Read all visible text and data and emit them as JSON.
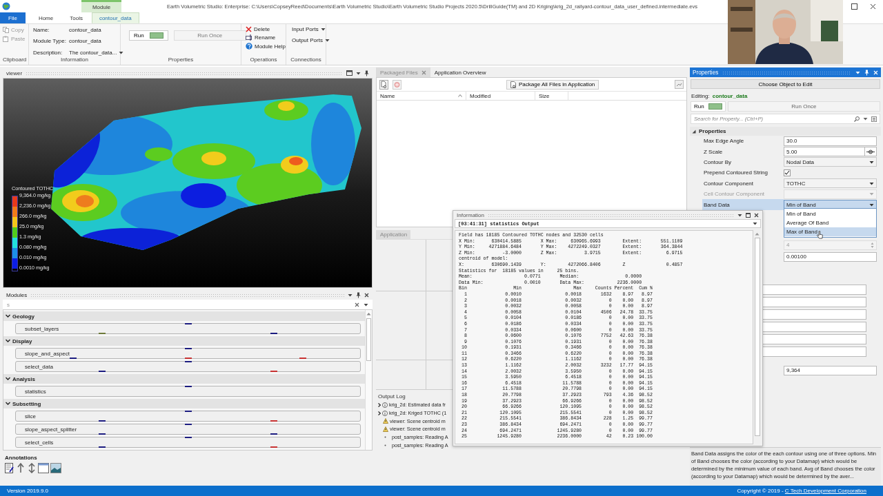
{
  "window": {
    "title": "Earth Volumetric Studio: Enterprise: C:\\Users\\CopseyReed\\Documents\\Earth Volumetric Studio\\Earth Volumetric Studio Projects 2020.5\\DrillGuide(TM) and 2D Kriging\\krig_2d_railyard-contour_data_user_defined.intermediate.evs",
    "context_group": "Module"
  },
  "ribbon_tabs": [
    {
      "label": "File",
      "kind": "file",
      "selected": false
    },
    {
      "label": "Home",
      "kind": "tab",
      "selected": false
    },
    {
      "label": "Tools",
      "kind": "tab",
      "selected": false
    },
    {
      "label": "contour_data",
      "kind": "context",
      "selected": true
    }
  ],
  "ribbon": {
    "clipboard": {
      "label": "Clipboard",
      "buttons": [
        {
          "label": "Copy",
          "kind": "copy",
          "disabled": true
        },
        {
          "label": "Paste",
          "kind": "paste",
          "disabled": true
        }
      ]
    },
    "information": {
      "label": "Information",
      "fields": [
        {
          "label": "Name:",
          "value": "contour_data",
          "kind": "text"
        },
        {
          "label": "Module Type:",
          "value": "contour_data",
          "kind": "text"
        },
        {
          "label": "Description:",
          "value": "The contour_data...",
          "kind": "dropdown"
        }
      ]
    },
    "properties": {
      "label": "Properties",
      "run": "Run",
      "run_once": "Run Once"
    },
    "operations": {
      "label": "Operations",
      "buttons": [
        {
          "label": "Delete",
          "kind": "delete"
        },
        {
          "label": "Rename",
          "kind": "rename"
        },
        {
          "label": "Module Help",
          "kind": "help"
        }
      ]
    },
    "connections": {
      "label": "Connections",
      "buttons": [
        {
          "label": "Input Ports"
        },
        {
          "label": "Output Ports"
        }
      ]
    }
  },
  "viewer": {
    "title": "viewer",
    "legend": {
      "title": "Contoured TOTHC",
      "labels": [
        "9,364.0 mg/kg",
        "2,236.0 mg/kg",
        "266.0 mg/kg",
        "25.0 mg/kg",
        "1.3 mg/kg",
        "0.080 mg/kg",
        "0.010 mg/kg",
        "0.0010 mg/kg"
      ],
      "bands": [
        {
          "color": "#e83a1c"
        },
        {
          "color": "#f07c1a"
        },
        {
          "color": "#f5c61a"
        },
        {
          "color": "#52cc1c"
        },
        {
          "color": "#22e0dc"
        },
        {
          "color": "#1c8ee8"
        },
        {
          "color": "#0c1ee6"
        }
      ]
    }
  },
  "modules": {
    "title": "Modules",
    "search_value": "s",
    "categories": [
      {
        "name": "Geology",
        "expanded": true,
        "items": [
          {
            "name": "subset_layers",
            "inputs": [
              {
                "color": "#1c1c80"
              }
            ],
            "outputs": [
              {
                "color": "#6e7a3a"
              },
              {
                "color": "#1c1c80"
              }
            ]
          }
        ]
      },
      {
        "name": "Display",
        "expanded": true,
        "items": [
          {
            "name": "slope_and_aspect",
            "inputs": [
              {
                "color": "#1c1c80"
              }
            ],
            "outputs": [
              {
                "color": "#1c1c80"
              },
              {
                "color": "#c83232"
              },
              {
                "color": "#c83232"
              }
            ]
          },
          {
            "name": "select_data",
            "inputs": [
              {
                "color": "#1c1c80"
              }
            ],
            "outputs": [
              {
                "color": "#1c1c80"
              },
              {
                "color": "#c83232"
              }
            ]
          }
        ]
      },
      {
        "name": "Analysis",
        "expanded": true,
        "items": [
          {
            "name": "statistics",
            "inputs": [
              {
                "color": "#1c1c80"
              }
            ]
          }
        ]
      },
      {
        "name": "Subsetting",
        "expanded": true,
        "items": [
          {
            "name": "slice",
            "inputs": [
              {
                "color": "#1c1c80"
              }
            ],
            "outputs": [
              {
                "color": "#1c1c80"
              },
              {
                "color": "#c83232"
              }
            ]
          },
          {
            "name": "slope_aspect_splitter",
            "inputs": [
              {
                "color": "#1c1c80"
              }
            ],
            "outputs": [
              {
                "color": "#1c1c80"
              },
              {
                "color": "#1c1c80"
              }
            ]
          },
          {
            "name": "select_cells",
            "inputs": [
              {
                "color": "#1c1c80"
              }
            ],
            "outputs": [
              {
                "color": "#1c1c80"
              },
              {
                "color": "#c83232"
              }
            ]
          }
        ]
      }
    ],
    "annotations_title": "Annotations"
  },
  "packaged_files": {
    "tabs": [
      {
        "label": "Packaged Files",
        "selected": true
      },
      {
        "label": "Application Overview",
        "selected": false
      }
    ],
    "package_button": "Package All Files in Application",
    "columns": [
      "Name",
      "Modified",
      "Size"
    ]
  },
  "application": {
    "title": "Application"
  },
  "output_log": {
    "title": "Output Log",
    "entries": [
      {
        "kind": "info",
        "text": "krig_2d: Estimated data fr"
      },
      {
        "kind": "info",
        "text": "krig_2d: Kriged TOTHC (1"
      },
      {
        "kind": "warning",
        "text": "viewer: Scene centroid m"
      },
      {
        "kind": "warning",
        "text": "viewer: Scene centroid m"
      },
      {
        "kind": "note",
        "text": "post_samples: Reading A"
      },
      {
        "kind": "note",
        "text": "post_samples: Reading A"
      }
    ]
  },
  "properties_panel": {
    "title": "Properties",
    "choose": "Choose Object to Edit",
    "editing_label": "Editing:",
    "editing_value": "contour_data",
    "run": "Run",
    "run_once": "Run Once",
    "search_placeholder": "Search for Property...  (Ctrl+P)",
    "section": "Properties",
    "rows": [
      {
        "label": "Max Edge Angle",
        "kind": "text",
        "value": "30.0",
        "selected": false,
        "disabled": false
      },
      {
        "label": "Z Scale",
        "kind": "text_button",
        "value": "5.00",
        "selected": false,
        "disabled": false
      },
      {
        "label": "Contour By",
        "kind": "dropdown",
        "value": "Nodal Data",
        "selected": false,
        "disabled": false
      },
      {
        "label": "Prepend Contoured String",
        "kind": "checkbox",
        "checked": true,
        "selected": false,
        "disabled": false
      },
      {
        "label": "Contour Component",
        "kind": "dropdown",
        "value": "TOTHC",
        "selected": false,
        "disabled": false
      },
      {
        "label": "Cell Contour Component",
        "kind": "dropdown",
        "selected": false,
        "disabled": true
      },
      {
        "label": "Band Data",
        "kind": "dropdown",
        "value": "Min of Band",
        "selected": true,
        "disabled": false
      }
    ],
    "band_data_options": [
      {
        "label": "Min of Band",
        "selected": false
      },
      {
        "label": "Average Of Band",
        "selected": false
      },
      {
        "label": "Max of Band",
        "selected": true
      }
    ],
    "lower_rows": [
      {
        "kind": "spin",
        "value": "4",
        "disabled": true
      },
      {
        "kind": "text",
        "value": "0.00100",
        "disabled": false
      },
      {
        "kind": "empty",
        "disabled": false
      },
      {
        "kind": "empty",
        "disabled": false
      },
      {
        "kind": "empty",
        "disabled": false
      },
      {
        "kind": "empty",
        "disabled": false
      },
      {
        "kind": "empty",
        "disabled": false
      },
      {
        "kind": "empty",
        "disabled": false
      },
      {
        "kind": "text",
        "value": "9,364",
        "disabled": false
      }
    ],
    "description": "Band Data assigns the color of the each contour using one of three options. Min of Band chooses the color (according to your Datamap) which would be determined by the minimum value of each band. Avg of Band chooses the color (according to your Datamap) which would be determined by the aver..."
  },
  "information_window": {
    "title": "Information",
    "header": "[03:41:31] statistics Output",
    "lines": [
      "Field has 18185 Contoured TOTHC nodes and 32530 cells",
      "X Min:      630414.5885       X Max:     630965.6993        Extent:       551.1109",
      "Y Min:     4271884.6484       Y Max:    4272249.0327        Extent:       364.3844",
      "Z Min:          -3.0000       Z Max:          3.9715        Extent:         6.9715",
      "centroid of model:",
      "X:          630690.1439       Y:        4272066.8406        Z               0.4857",
      "Statistics for  18185 values in     25 bins.",
      "Mean:                   0.0771       Median:                 0.0000",
      "Data Min:               0.0010       Data Max:            2236.0000"
    ],
    "bin_columns": [
      "Bin",
      "Min",
      "Max",
      "Counts",
      "Percent",
      "Cum %"
    ],
    "bins": [
      {
        "bin": "1",
        "min": "0.0010",
        "max": "0.0018",
        "counts": "1632",
        "percent": "8.97",
        "cum": "8.97"
      },
      {
        "bin": "2",
        "min": "0.0018",
        "max": "0.0032",
        "counts": "0",
        "percent": "0.00",
        "cum": "8.97"
      },
      {
        "bin": "3",
        "min": "0.0032",
        "max": "0.0058",
        "counts": "0",
        "percent": "0.00",
        "cum": "8.97"
      },
      {
        "bin": "4",
        "min": "0.0058",
        "max": "0.0104",
        "counts": "4506",
        "percent": "24.78",
        "cum": "33.75"
      },
      {
        "bin": "5",
        "min": "0.0104",
        "max": "0.0186",
        "counts": "0",
        "percent": "0.00",
        "cum": "33.75"
      },
      {
        "bin": "6",
        "min": "0.0186",
        "max": "0.0334",
        "counts": "0",
        "percent": "0.00",
        "cum": "33.75"
      },
      {
        "bin": "7",
        "min": "0.0334",
        "max": "0.0600",
        "counts": "0",
        "percent": "0.00",
        "cum": "33.75"
      },
      {
        "bin": "8",
        "min": "0.0600",
        "max": "0.1076",
        "counts": "7752",
        "percent": "42.63",
        "cum": "76.38"
      },
      {
        "bin": "9",
        "min": "0.1076",
        "max": "0.1931",
        "counts": "0",
        "percent": "0.00",
        "cum": "76.38"
      },
      {
        "bin": "10",
        "min": "0.1931",
        "max": "0.3466",
        "counts": "0",
        "percent": "0.00",
        "cum": "76.38"
      },
      {
        "bin": "11",
        "min": "0.3466",
        "max": "0.6220",
        "counts": "0",
        "percent": "0.00",
        "cum": "76.38"
      },
      {
        "bin": "12",
        "min": "0.6220",
        "max": "1.1162",
        "counts": "0",
        "percent": "0.00",
        "cum": "76.38"
      },
      {
        "bin": "13",
        "min": "1.1162",
        "max": "2.0032",
        "counts": "3232",
        "percent": "17.77",
        "cum": "94.15"
      },
      {
        "bin": "14",
        "min": "2.0032",
        "max": "3.5950",
        "counts": "0",
        "percent": "0.00",
        "cum": "94.15"
      },
      {
        "bin": "15",
        "min": "3.5950",
        "max": "6.4518",
        "counts": "0",
        "percent": "0.00",
        "cum": "94.15"
      },
      {
        "bin": "16",
        "min": "6.4518",
        "max": "11.5788",
        "counts": "0",
        "percent": "0.00",
        "cum": "94.15"
      },
      {
        "bin": "17",
        "min": "11.5788",
        "max": "20.7798",
        "counts": "0",
        "percent": "0.00",
        "cum": "94.15"
      },
      {
        "bin": "18",
        "min": "20.7798",
        "max": "37.2923",
        "counts": "793",
        "percent": "4.36",
        "cum": "98.52"
      },
      {
        "bin": "19",
        "min": "37.2923",
        "max": "66.9266",
        "counts": "0",
        "percent": "0.00",
        "cum": "98.52"
      },
      {
        "bin": "20",
        "min": "66.9266",
        "max": "120.1095",
        "counts": "0",
        "percent": "0.00",
        "cum": "98.52"
      },
      {
        "bin": "21",
        "min": "120.1095",
        "max": "215.5541",
        "counts": "0",
        "percent": "0.00",
        "cum": "98.52"
      },
      {
        "bin": "22",
        "min": "215.5541",
        "max": "386.8434",
        "counts": "228",
        "percent": "1.25",
        "cum": "99.77"
      },
      {
        "bin": "23",
        "min": "386.8434",
        "max": "694.2471",
        "counts": "0",
        "percent": "0.00",
        "cum": "99.77"
      },
      {
        "bin": "24",
        "min": "694.2471",
        "max": "1245.9280",
        "counts": "0",
        "percent": "0.00",
        "cum": "99.77"
      },
      {
        "bin": "25",
        "min": "1245.9280",
        "max": "2236.0000",
        "counts": "42",
        "percent": "0.23",
        "cum": "100.00"
      }
    ]
  },
  "status_bar": {
    "version": "Version 2019.9.0",
    "copyright": "Copyright © 2019 - ",
    "company": "C Tech Development Corporation"
  }
}
